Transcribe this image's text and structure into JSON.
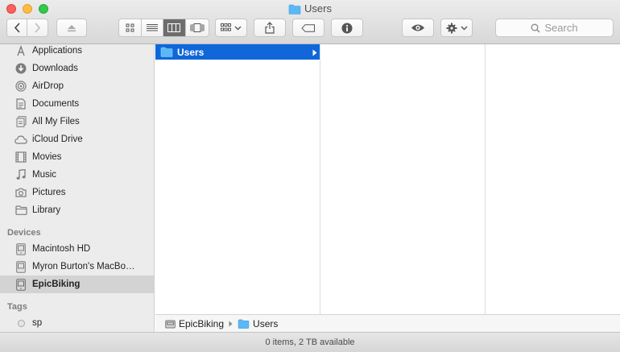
{
  "window": {
    "title": "Users"
  },
  "toolbar": {
    "search_placeholder": "Search",
    "view_modes": [
      "icon-view",
      "list-view",
      "column-view",
      "cover-flow-view"
    ],
    "active_view": "column-view"
  },
  "sidebar": {
    "favorites": [
      {
        "label": "Applications",
        "icon": "applications-icon"
      },
      {
        "label": "Downloads",
        "icon": "downloads-icon"
      },
      {
        "label": "AirDrop",
        "icon": "airdrop-icon"
      },
      {
        "label": "Documents",
        "icon": "documents-icon"
      },
      {
        "label": "All My Files",
        "icon": "all-my-files-icon"
      },
      {
        "label": "iCloud Drive",
        "icon": "icloud-icon"
      },
      {
        "label": "Movies",
        "icon": "movies-icon"
      },
      {
        "label": "Music",
        "icon": "music-icon"
      },
      {
        "label": "Pictures",
        "icon": "camera-icon"
      },
      {
        "label": "Library",
        "icon": "folder-icon"
      }
    ],
    "devices_header": "Devices",
    "devices": [
      {
        "label": "Macintosh HD",
        "icon": "hard-drive-icon"
      },
      {
        "label": "Myron Burton's MacBo…",
        "icon": "laptop-icon"
      },
      {
        "label": "EpicBiking",
        "icon": "external-drive-icon",
        "selected": true
      }
    ],
    "tags_header": "Tags",
    "tags": [
      {
        "label": "sp",
        "color": "#e4e4e4"
      }
    ]
  },
  "columns": {
    "col1_items": [
      {
        "label": "Users",
        "selected": true
      }
    ]
  },
  "pathbar": {
    "items": [
      "EpicBiking",
      "Users"
    ]
  },
  "status": {
    "text": "0 items, 2 TB available"
  },
  "colors": {
    "selection": "#0f67d9",
    "folder": "#5bb8f5"
  }
}
